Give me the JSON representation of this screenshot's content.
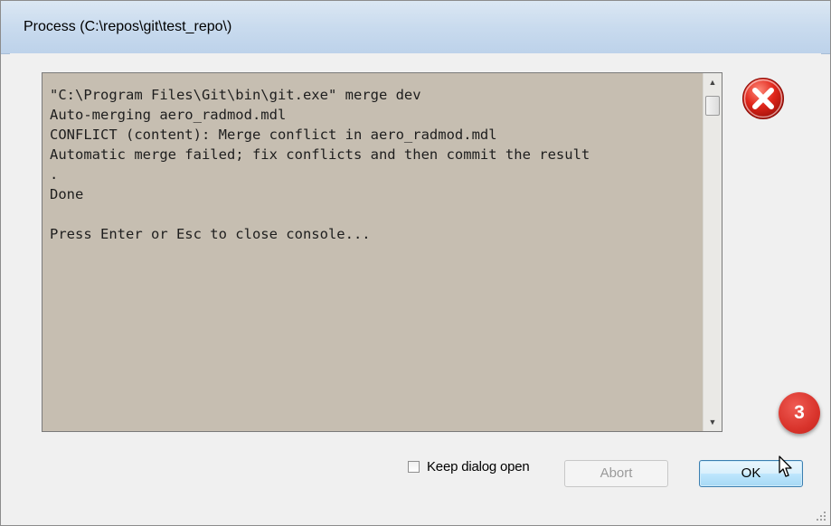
{
  "window": {
    "title": "Process (C:\\repos\\git\\test_repo\\)"
  },
  "console": {
    "lines": "\"C:\\Program Files\\Git\\bin\\git.exe\" merge dev\nAuto-merging aero_radmod.mdl\nCONFLICT (content): Merge conflict in aero_radmod.mdl\nAutomatic merge failed; fix conflicts and then commit the result\n.\nDone\n\nPress Enter or Esc to close console..."
  },
  "footer": {
    "keep_open_label": "Keep dialog open",
    "keep_open_checked": false,
    "abort_label": "Abort",
    "ok_label": "OK"
  },
  "annotation": {
    "step_number": "3",
    "color": "#d9342c"
  },
  "icons": {
    "status": "error-icon",
    "cursor": "mouse-pointer-icon"
  }
}
